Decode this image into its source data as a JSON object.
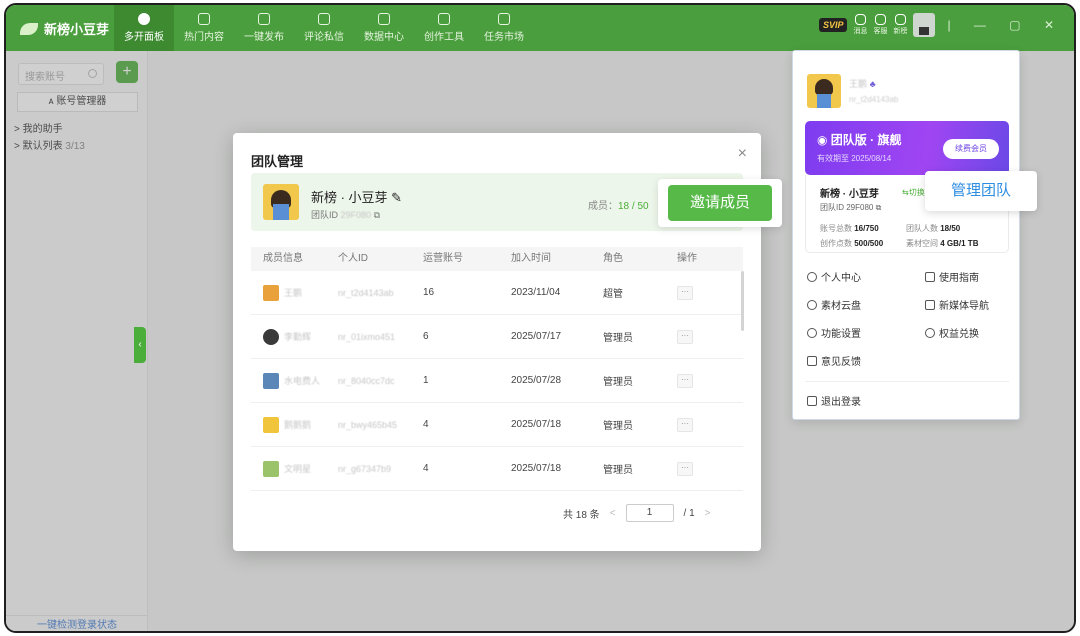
{
  "app": {
    "name": "新榜小豆芽"
  },
  "nav": [
    {
      "label": "多开面板",
      "active": true
    },
    {
      "label": "热门内容"
    },
    {
      "label": "一键发布"
    },
    {
      "label": "评论私信"
    },
    {
      "label": "数据中心"
    },
    {
      "label": "创作工具"
    },
    {
      "label": "任务市场"
    }
  ],
  "topbar_right": {
    "svip": "SVIP",
    "icons": [
      {
        "label": "消息",
        "icon": "bell-icon"
      },
      {
        "label": "客服",
        "icon": "headset-icon"
      },
      {
        "label": "新榜",
        "icon": "newrank-icon"
      }
    ],
    "window_controls": "| — ▢ ✕"
  },
  "sidebar": {
    "search_placeholder": "搜索账号",
    "add_label": "+",
    "account_manager": "账号管理器",
    "tree": [
      {
        "label": "> 我的助手"
      },
      {
        "label": "> 默认列表",
        "count": "3/13"
      }
    ],
    "check_login": "一键检测登录状态",
    "collapse": "‹"
  },
  "modal": {
    "title": "团队管理",
    "close": "×",
    "team_name": "新榜 · 小豆芽 ✎",
    "team_id_label": "团队ID",
    "team_id_value": "29F080",
    "members_label": "成员：",
    "members_value": "18 / 50",
    "invite_button": "邀请成员",
    "columns": [
      "成员信息",
      "个人ID",
      "运营账号",
      "加入时间",
      "角色",
      "操作"
    ],
    "rows": [
      {
        "name": "王鹏",
        "id": "nr_t2d4143ab",
        "accounts": "16",
        "joined": "2023/11/04",
        "role": "超管",
        "avatar_color": "#e9a23b"
      },
      {
        "name": "李勤辉",
        "id": "nr_01ixmo451",
        "accounts": "6",
        "joined": "2025/07/17",
        "role": "管理员",
        "avatar_color": "#3a3a3a"
      },
      {
        "name": "水电费人",
        "id": "nr_8040cc7dc",
        "accounts": "1",
        "joined": "2025/07/28",
        "role": "管理员",
        "avatar_color": "#5b86b8"
      },
      {
        "name": "鹅鹅鹅",
        "id": "nr_bwy465b45",
        "accounts": "4",
        "joined": "2025/07/18",
        "role": "管理员",
        "avatar_color": "#f0c53c"
      },
      {
        "name": "文明星",
        "id": "nr_g67347b9",
        "accounts": "4",
        "joined": "2025/07/18",
        "role": "管理员",
        "avatar_color": "#9bc46a"
      }
    ],
    "more": "···",
    "pager": {
      "total": "共 18 条",
      "prev": "<",
      "page": "1",
      "of": "/ 1",
      "next": ">"
    }
  },
  "popover": {
    "user_name": "王鹏",
    "user_badge": "♣",
    "user_id": "nr_t2d4143ab",
    "tier_title": "◉ 团队版 · 旗舰",
    "tier_expiry": "有效期至 2025/08/14",
    "renew": "续费会员",
    "team_name": "新榜 · 小豆芽",
    "switch": "⇆切换",
    "team_id": "团队ID 29F080 ⧉",
    "stats": [
      {
        "label": "账号总数",
        "value": "16/750"
      },
      {
        "label": "团队人数",
        "value": "18/50"
      },
      {
        "label": "创作点数",
        "value": "500/500"
      },
      {
        "label": "素材空间",
        "value": "4 GB/1 TB"
      }
    ],
    "menu": [
      {
        "label": "个人中心",
        "icon": "user-icon"
      },
      {
        "label": "使用指南",
        "icon": "guide-icon"
      },
      {
        "label": "素材云盘",
        "icon": "cloud-icon"
      },
      {
        "label": "新媒体导航",
        "icon": "grid-icon"
      },
      {
        "label": "功能设置",
        "icon": "gear-icon"
      },
      {
        "label": "权益兑换",
        "icon": "heart-icon"
      },
      {
        "label": "意见反馈",
        "icon": "feedback-icon"
      }
    ],
    "logout": "退出登录",
    "manage_team_callout": "管理团队"
  },
  "colors": {
    "brand": "#4a9e3d",
    "accent": "#56b948",
    "tier": "#8a3ff0",
    "link": "#2d8de0"
  }
}
